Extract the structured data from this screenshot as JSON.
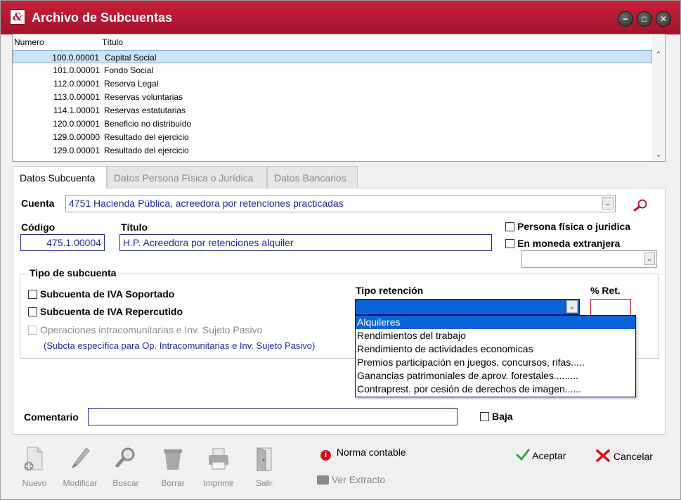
{
  "window": {
    "title": "Archivo de Subcuentas",
    "min_glyph": "−",
    "max_glyph": "□",
    "close_glyph": "✕"
  },
  "list": {
    "col_numero": "Numero",
    "col_titulo": "Título",
    "rows": [
      {
        "num": "100.0.00001",
        "tit": "Capital Social"
      },
      {
        "num": "101.0.00001",
        "tit": "Fondo Social"
      },
      {
        "num": "112.0.00001",
        "tit": "Reserva Legal"
      },
      {
        "num": "113.0.00001",
        "tit": "Reservas voluntarias"
      },
      {
        "num": "114.1.00001",
        "tit": "Reservas estatutarias"
      },
      {
        "num": "120.0.00001",
        "tit": "Beneficio no distribuido"
      },
      {
        "num": "129.0.00000",
        "tit": "Resultado del ejercicio"
      },
      {
        "num": "129.0.00001",
        "tit": "Resultado del ejercicio"
      }
    ]
  },
  "tabs": [
    {
      "label": "Datos Subcuenta"
    },
    {
      "label": "Datos Persona Física o Jurídica"
    },
    {
      "label": "Datos Bancarios"
    }
  ],
  "form": {
    "cuenta_label": "Cuenta",
    "cuenta_value": "4751  Hacienda Pública, acreedora por retenciones practicadas",
    "codigo_label": "Código",
    "codigo_value": "475.1.00004",
    "titulo_label": "Título",
    "titulo_value": "H.P. Acreedora por retenciones alquiler",
    "persona_label": "Persona física o juridica",
    "moneda_label": "En moneda extranjera",
    "tipo_group_label": "Tipo de subcuenta",
    "iva_soportado_label": "Subcuenta de IVA Soportado",
    "iva_repercutido_label": "Subcuenta de IVA Repercutido",
    "intracom_label": "Operaciones intracomunitarias e Inv. Sujeto Pasivo",
    "intracom_note": "(Subcta específica para Op. Intracomunitarias e Inv. Sujeto Pasivo)",
    "tipo_retencion_label": "Tipo retención",
    "ret_pct_label": "% Ret.",
    "retencion_options": [
      "Alquileres",
      "Rendimientos del trabajo",
      "Rendimiento de actividades economicas",
      "Premios participación en juegos, concursos, rifas.....",
      "Ganancias patrimoniales de aprov. forestales.........",
      "Contraprest. por cesión de derechos de imagen......"
    ],
    "comentario_label": "Comentario",
    "baja_label": "Baja"
  },
  "toolbar": {
    "nuevo": "Nuevo",
    "modificar": "Modificar",
    "buscar": "Buscar",
    "borrar": "Borrar",
    "imprimir": "Imprimir",
    "salir": "Salir",
    "norma": "Norma contable",
    "extracto": "Ver Extracto",
    "aceptar": "Aceptar",
    "cancelar": "Cancelar"
  },
  "colors": {
    "titlebar": "#b01530",
    "selection": "#0a64d8",
    "input_text": "#1d2aa0"
  }
}
